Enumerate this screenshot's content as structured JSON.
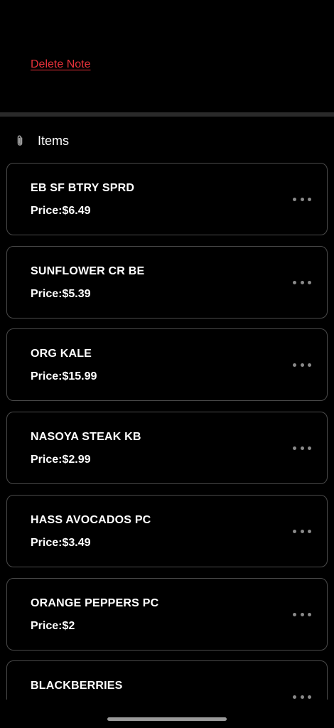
{
  "note": {
    "delete_label": "Delete Note"
  },
  "items_section": {
    "title": "Items",
    "icon": "paperclip-icon"
  },
  "items": [
    {
      "name": "EB SF BTRY SPRD",
      "price": "Price:$6.49"
    },
    {
      "name": "SUNFLOWER CR BE",
      "price": "Price:$5.39"
    },
    {
      "name": "ORG KALE",
      "price": "Price:$15.99"
    },
    {
      "name": "NASOYA STEAK KB",
      "price": "Price:$2.99"
    },
    {
      "name": "HASS AVOCADOS PC",
      "price": "Price:$3.49"
    },
    {
      "name": "ORANGE PEPPERS PC",
      "price": "Price:$2"
    },
    {
      "name": "BLACKBERRIES",
      "price": ""
    }
  ],
  "colors": {
    "background": "#000000",
    "accent_red": "#e8313a",
    "card_border": "#4a4a4a",
    "divider": "#2a2a2a"
  }
}
